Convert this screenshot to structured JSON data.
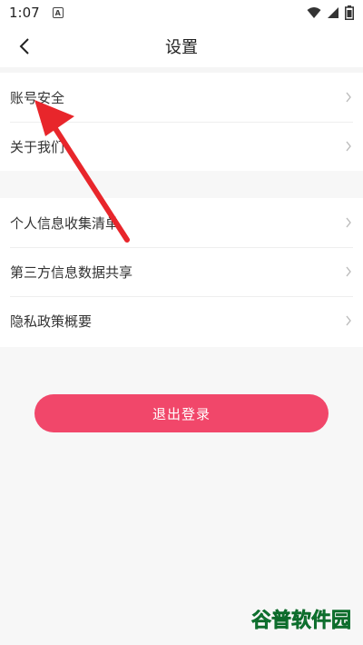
{
  "status_bar": {
    "time": "1:07",
    "notif_glyph": "A",
    "icons": [
      "wifi-icon",
      "signal-icon",
      "battery-icon"
    ]
  },
  "header": {
    "title": "设置",
    "back_icon": "back-arrow-icon"
  },
  "settings_group_1": {
    "items": [
      {
        "label": "账号安全"
      },
      {
        "label": "关于我们"
      }
    ]
  },
  "settings_group_2": {
    "items": [
      {
        "label": "个人信息收集清单"
      },
      {
        "label": "第三方信息数据共享"
      },
      {
        "label": "隐私政策概要"
      }
    ]
  },
  "logout": {
    "label": "退出登录"
  },
  "watermark": {
    "text": "谷普软件园"
  },
  "colors": {
    "accent": "#f1476a",
    "arrow": "#e8262b",
    "background": "#f7f7f7"
  }
}
